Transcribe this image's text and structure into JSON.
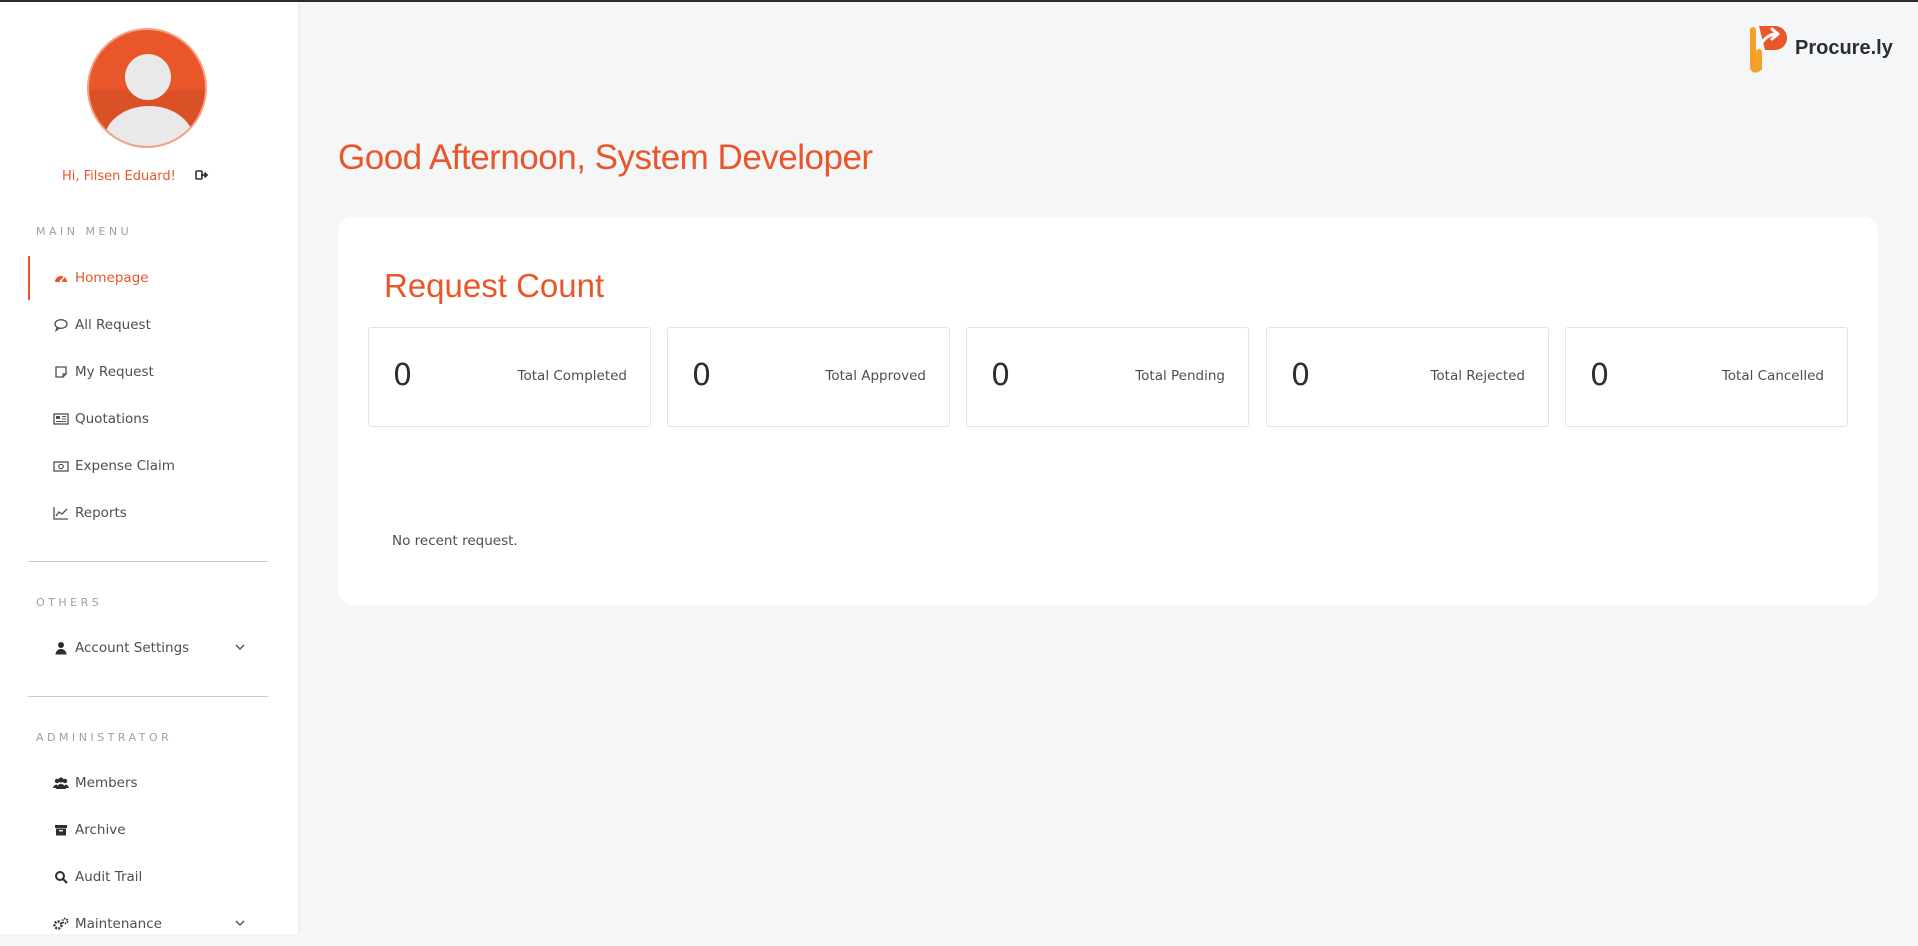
{
  "app": {
    "name": "Procure.ly",
    "accent_color": "#e8562a"
  },
  "user": {
    "greeting": "Hi, Filsen Eduard!",
    "avatar_icon": "user-avatar-icon",
    "logout_icon": "logout-icon"
  },
  "sidebar": {
    "main_menu_label": "MAIN MENU",
    "main_menu": [
      {
        "label": "Homepage",
        "icon": "dashboard-icon",
        "active": true
      },
      {
        "label": "All Request",
        "icon": "chat-bubble-icon"
      },
      {
        "label": "My Request",
        "icon": "note-icon"
      },
      {
        "label": "Quotations",
        "icon": "newspaper-icon"
      },
      {
        "label": "Expense Claim",
        "icon": "money-bill-icon"
      },
      {
        "label": "Reports",
        "icon": "line-chart-icon"
      }
    ],
    "others_label": "OTHERS",
    "others": [
      {
        "label": "Account Settings",
        "icon": "user-icon",
        "expandable": true
      }
    ],
    "admin_label": "ADMINISTRATOR",
    "admin": [
      {
        "label": "Members",
        "icon": "users-icon"
      },
      {
        "label": "Archive",
        "icon": "archive-icon"
      },
      {
        "label": "Audit Trail",
        "icon": "search-icon"
      },
      {
        "label": "Maintenance",
        "icon": "gears-icon",
        "expandable": true
      }
    ]
  },
  "main": {
    "greeting": "Good Afternoon, System Developer",
    "panel_title": "Request Count",
    "stats": [
      {
        "value": "0",
        "label": "Total Completed"
      },
      {
        "value": "0",
        "label": "Total Approved"
      },
      {
        "value": "0",
        "label": "Total Pending"
      },
      {
        "value": "0",
        "label": "Total Rejected"
      },
      {
        "value": "0",
        "label": "Total Cancelled"
      }
    ],
    "empty_message": "No recent request."
  }
}
